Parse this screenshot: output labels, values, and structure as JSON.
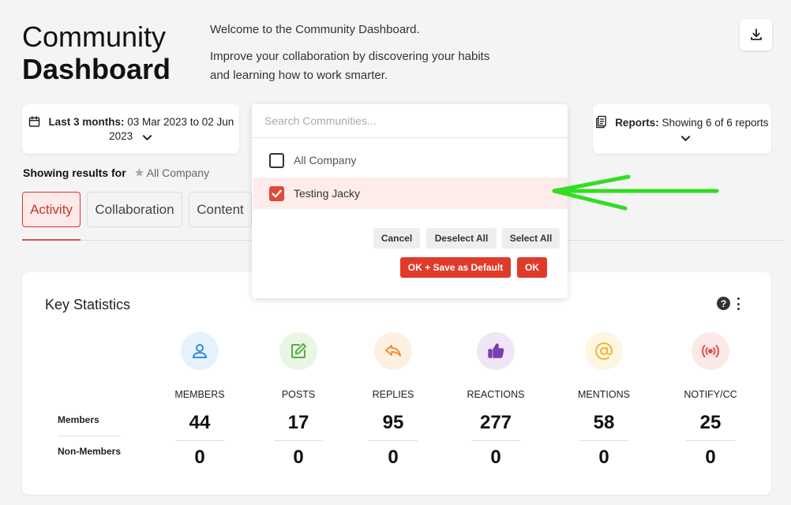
{
  "header": {
    "title_line1": "Community",
    "title_line2": "Dashboard",
    "welcome": "Welcome to the Community Dashboard.",
    "description": "Improve your collaboration by discovering your habits and learning how to work smarter.",
    "download_icon": "download-icon"
  },
  "date_filter": {
    "label": "Last 3 months:",
    "range": "03 Mar 2023 to 02 Jun 2023",
    "icon": "calendar-icon"
  },
  "search": {
    "placeholder": "Search Communities...",
    "options": [
      {
        "label": "All Company",
        "checked": false
      },
      {
        "label": "Testing Jacky",
        "checked": true
      }
    ],
    "buttons": {
      "cancel": "Cancel",
      "deselect_all": "Deselect All",
      "select_all": "Select All",
      "ok_save_default": "OK + Save as Default",
      "ok": "OK"
    }
  },
  "reports": {
    "label": "Reports:",
    "value": "Showing 6 of 6 reports",
    "icon": "reports-icon"
  },
  "showing": {
    "label": "Showing results for",
    "scope": "All Company"
  },
  "tabs": [
    "Activity",
    "Collaboration",
    "Content"
  ],
  "active_tab": "Activity",
  "stats": {
    "title": "Key Statistics",
    "row_labels": [
      "Members",
      "Non-Members"
    ],
    "columns": [
      {
        "label": "MEMBERS",
        "members": "44",
        "non_members": "0",
        "icon": "user-icon",
        "color": "#2f8fe0",
        "bg": "#e6f2fb"
      },
      {
        "label": "POSTS",
        "members": "17",
        "non_members": "0",
        "icon": "edit-icon",
        "color": "#5aad3e",
        "bg": "#eaf5e6"
      },
      {
        "label": "REPLIES",
        "members": "95",
        "non_members": "0",
        "icon": "reply-icon",
        "color": "#f0932b",
        "bg": "#fdf0e3"
      },
      {
        "label": "REACTIONS",
        "members": "277",
        "non_members": "0",
        "icon": "thumbs-up-icon",
        "color": "#7b3fb5",
        "bg": "#efe6f7"
      },
      {
        "label": "MENTIONS",
        "members": "58",
        "non_members": "0",
        "icon": "at-icon",
        "color": "#f2b62c",
        "bg": "#fdf6e2"
      },
      {
        "label": "NOTIFY/CC",
        "members": "25",
        "non_members": "0",
        "icon": "broadcast-icon",
        "color": "#d9534f",
        "bg": "#fbe9e8"
      }
    ]
  }
}
